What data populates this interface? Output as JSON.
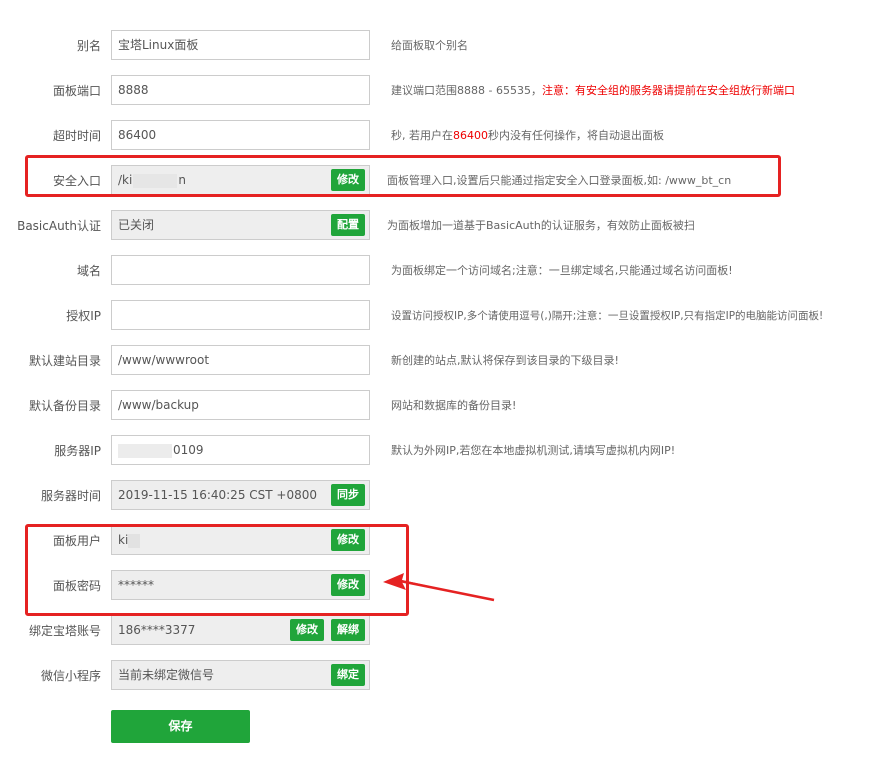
{
  "rows": {
    "alias": {
      "label": "别名",
      "value": "宝塔Linux面板",
      "desc": "给面板取个别名"
    },
    "port": {
      "label": "面板端口",
      "value": "8888",
      "desc": "建议端口范围8888 - 65535，",
      "desc_warn": "注意：有安全组的服务器请提前在安全组放行新端口"
    },
    "timeout": {
      "label": "超时时间",
      "value": "86400",
      "desc_pre": "秒, 若用户在",
      "desc_num": "86400",
      "desc_post": "秒内没有任何操作，将自动退出面板"
    },
    "entry": {
      "label": "安全入口",
      "value_a": "/ki",
      "value_b": "n",
      "button": "修改",
      "desc": "面板管理入口,设置后只能通过指定安全入口登录面板,如: /www_bt_cn"
    },
    "basicauth": {
      "label": "BasicAuth认证",
      "value": "已关闭",
      "button": "配置",
      "desc": "为面板增加一道基于BasicAuth的认证服务，有效防止面板被扫"
    },
    "domain": {
      "label": "域名",
      "value": "",
      "desc": "为面板绑定一个访问域名;注意：一旦绑定域名,只能通过域名访问面板!"
    },
    "auth_ip": {
      "label": "授权IP",
      "value": "",
      "desc": "设置访问授权IP,多个请使用逗号(,)隔开;注意：一旦设置授权IP,只有指定IP的电脑能访问面板!"
    },
    "site_dir": {
      "label": "默认建站目录",
      "value": "/www/wwwroot",
      "desc": "新创建的站点,默认将保存到该目录的下级目录!"
    },
    "backup_dir": {
      "label": "默认备份目录",
      "value": "/www/backup",
      "desc": "网站和数据库的备份目录!"
    },
    "server_ip": {
      "label": "服务器IP",
      "value": "0109",
      "desc": "默认为外网IP,若您在本地虚拟机测试,请填写虚拟机内网IP!"
    },
    "server_time": {
      "label": "服务器时间",
      "value": "2019-11-15 16:40:25 CST +0800",
      "button": "同步"
    },
    "panel_user": {
      "label": "面板用户",
      "value": "ki",
      "button": "修改"
    },
    "panel_pass": {
      "label": "面板密码",
      "value": "******",
      "button": "修改"
    },
    "bt_account": {
      "label": "绑定宝塔账号",
      "value": "186****3377",
      "button_edit": "修改",
      "button_unbind": "解绑"
    },
    "wechat": {
      "label": "微信小程序",
      "value": "当前未绑定微信号",
      "button": "绑定"
    }
  },
  "save_label": "保存",
  "accent_color": "#20a53a",
  "annotation_color": "#e52222"
}
